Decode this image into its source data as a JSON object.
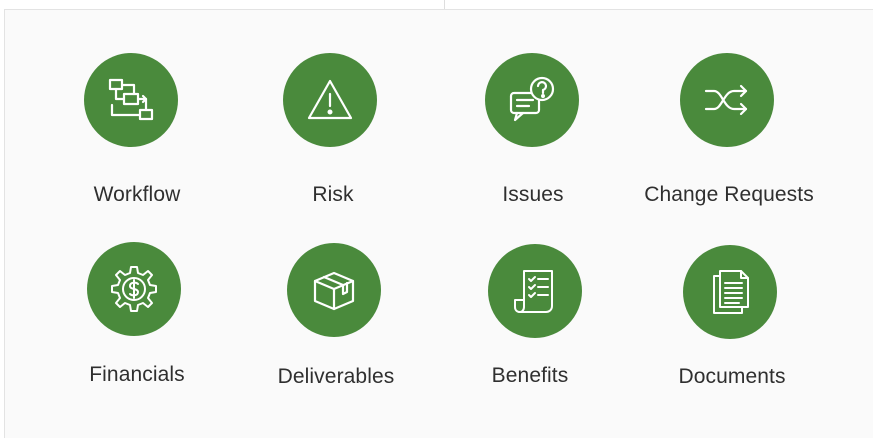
{
  "tiles": [
    {
      "key": "workflow",
      "label": "Workflow",
      "icon": "workflow-icon"
    },
    {
      "key": "risk",
      "label": "Risk",
      "icon": "warning-icon"
    },
    {
      "key": "issues",
      "label": "Issues",
      "icon": "question-chat-icon"
    },
    {
      "key": "change-requests",
      "label": "Change Requests",
      "icon": "shuffle-icon"
    },
    {
      "key": "financials",
      "label": "Financials",
      "icon": "dollar-gear-icon"
    },
    {
      "key": "deliverables",
      "label": "Deliverables",
      "icon": "package-icon"
    },
    {
      "key": "benefits",
      "label": "Benefits",
      "icon": "checklist-icon"
    },
    {
      "key": "documents",
      "label": "Documents",
      "icon": "documents-icon"
    }
  ],
  "colors": {
    "tile_circle": "#4a8a3c",
    "icon_stroke": "#ffffff",
    "label_text": "#2f2f2f",
    "panel_background": "#fafafa"
  }
}
